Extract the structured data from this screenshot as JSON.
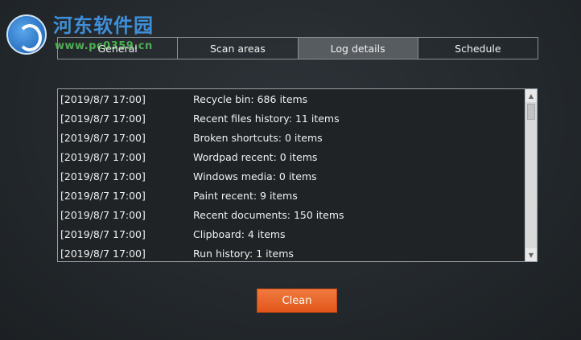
{
  "watermark": {
    "title": "河东软件园",
    "url": "www.pc0359.cn"
  },
  "tabs": [
    {
      "label": "General",
      "active": false
    },
    {
      "label": "Scan areas",
      "active": false
    },
    {
      "label": "Log details",
      "active": true
    },
    {
      "label": "Schedule",
      "active": false
    }
  ],
  "log": {
    "rows": [
      {
        "time": "[2019/8/7 17:00]",
        "message": "Recycle bin: 686 items"
      },
      {
        "time": "[2019/8/7 17:00]",
        "message": "Recent files history: 11 items"
      },
      {
        "time": "[2019/8/7 17:00]",
        "message": "Broken shortcuts: 0 items"
      },
      {
        "time": "[2019/8/7 17:00]",
        "message": "Wordpad recent: 0 items"
      },
      {
        "time": "[2019/8/7 17:00]",
        "message": "Windows media: 0 items"
      },
      {
        "time": "[2019/8/7 17:00]",
        "message": "Paint recent: 9 items"
      },
      {
        "time": "[2019/8/7 17:00]",
        "message": "Recent documents: 150 items"
      },
      {
        "time": "[2019/8/7 17:00]",
        "message": "Clipboard: 4 items"
      },
      {
        "time": "[2019/8/7 17:00]",
        "message": "Run history: 1 items"
      }
    ]
  },
  "scrollbar": {
    "up_icon": "triangle-up-icon",
    "down_icon": "triangle-down-icon"
  },
  "actions": {
    "clean_label": "Clean"
  },
  "colors": {
    "accent": "#e8601f",
    "active_tab": "#575c60",
    "background": "#262b2f"
  }
}
